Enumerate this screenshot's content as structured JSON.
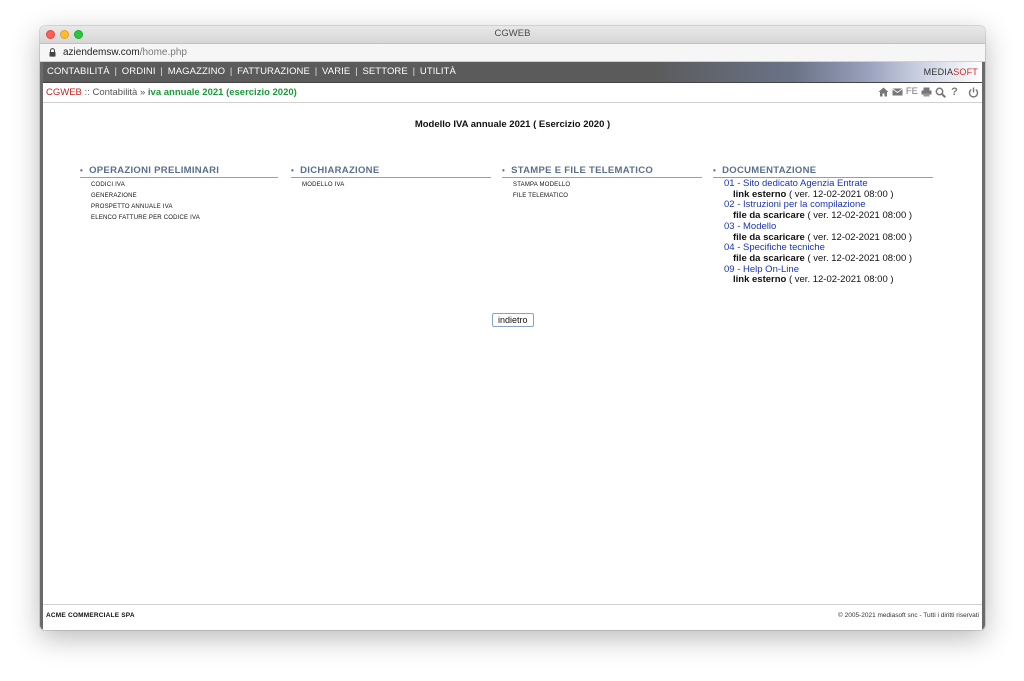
{
  "window": {
    "title": "CGWEB",
    "url_host": "aziendemsw.com",
    "url_path": "/home.php"
  },
  "menu": {
    "items": [
      "CONTABILITÀ",
      "ORDINI",
      "MAGAZZINO",
      "FATTURAZIONE",
      "VARIE",
      "SETTORE",
      "UTILITÀ"
    ],
    "separator": "|",
    "brand_main": "MEDIA",
    "brand_accent": "SOFT"
  },
  "breadcrumb": {
    "app": "CGWEB",
    "sep1": " :: ",
    "section": "Contabilità",
    "sep2": " » ",
    "current": "iva annuale 2021 (esercizio 2020)"
  },
  "toolbar": {
    "icons": [
      "home-icon",
      "mail-icon",
      "fe-label",
      "printer-icon",
      "search-icon",
      "help-icon",
      "power-icon"
    ],
    "fe_label": "FE"
  },
  "page": {
    "title": "Modello IVA annuale 2021 ( Esercizio 2020 )"
  },
  "columns": [
    {
      "heading": "OPERAZIONI PRELIMINARI",
      "items": [
        "CODICI IVA",
        "GENERAZIONE",
        "PROSPETTO ANNUALE IVA",
        "ELENCO FATTURE PER CODICE IVA"
      ]
    },
    {
      "heading": "DICHIARAZIONE",
      "items": [
        "MODELLO IVA"
      ]
    },
    {
      "heading": "STAMPE E FILE TELEMATICO",
      "items": [
        "STAMPA MODELLO",
        "FILE TELEMATICO"
      ]
    }
  ],
  "documentation": {
    "heading": "DOCUMENTAZIONE",
    "entries": [
      {
        "title": "01 - Sito dedicato Agenzia Entrate",
        "kind": "link esterno",
        "version": " ( ver. 12-02-2021 08:00 )"
      },
      {
        "title": "02 - Istruzioni per la compilazione",
        "kind": "file da scaricare",
        "version": " ( ver. 12-02-2021 08:00 )"
      },
      {
        "title": "03 - Modello",
        "kind": "file da scaricare",
        "version": " ( ver. 12-02-2021 08:00 )"
      },
      {
        "title": "04 - Specifiche tecniche",
        "kind": "file da scaricare",
        "version": " ( ver. 12-02-2021 08:00 )"
      },
      {
        "title": "09 - Help On-Line",
        "kind": "link esterno",
        "version": " ( ver. 12-02-2021 08:00 )"
      }
    ]
  },
  "back_button": "indietro",
  "footer": {
    "company": "ACME COMMERCIALE SPA",
    "copyright": "© 2005-2021 mediasoft snc - Tutti i diritti riservati"
  }
}
